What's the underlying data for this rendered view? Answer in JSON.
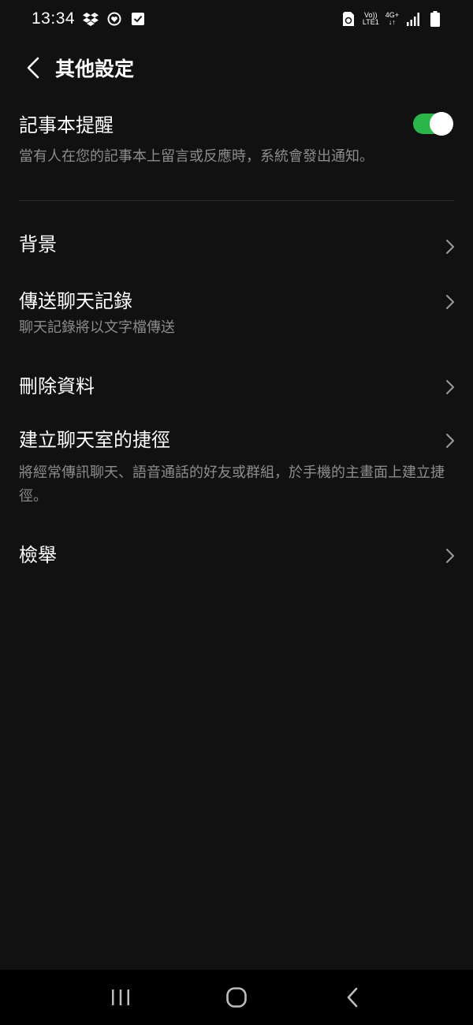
{
  "status_bar": {
    "time": "13:34",
    "volte": "Vo))",
    "lte": "LTE1",
    "network": "4G+",
    "icons": [
      "dropbox-icon",
      "sync-heart-icon",
      "check-square-icon",
      "recycle-sim-icon",
      "signal-icon",
      "battery-icon"
    ]
  },
  "header": {
    "title": "其他設定"
  },
  "settings": {
    "note_reminder": {
      "title": "記事本提醒",
      "description": "當有人在您的記事本上留言或反應時，系統會發出通知。",
      "enabled": true
    },
    "background": {
      "title": "背景"
    },
    "send_chat_history": {
      "title": "傳送聊天記錄",
      "description": "聊天記錄將以文字檔傳送"
    },
    "delete_data": {
      "title": "刪除資料"
    },
    "create_shortcut": {
      "title": "建立聊天室的捷徑",
      "description": "將經常傳訊聊天、語音通話的好友或群組，於手機的主畫面上建立捷徑。"
    },
    "report": {
      "title": "檢舉"
    }
  },
  "colors": {
    "background": "#111111",
    "toggle_on": "#2bb649",
    "secondary_text": "#8c8c8c"
  }
}
